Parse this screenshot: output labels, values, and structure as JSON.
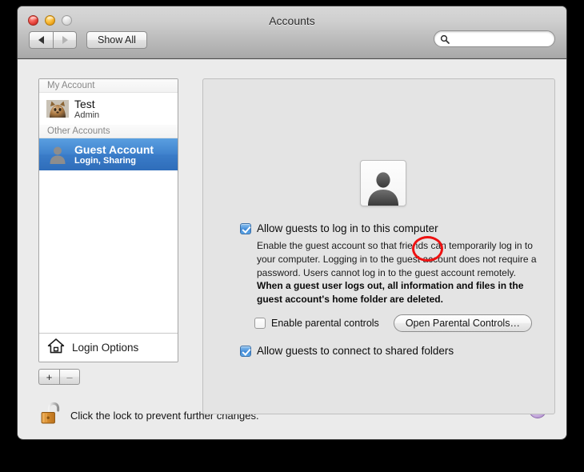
{
  "window": {
    "title": "Accounts",
    "traffic_lights": {
      "close": "close-button",
      "minimize": "minimize-button",
      "zoom": "zoom-button"
    }
  },
  "toolbar": {
    "back_label": "◀",
    "forward_label": "▶",
    "show_all_label": "Show All",
    "search_placeholder": "",
    "search_value": ""
  },
  "sidebar": {
    "groups": [
      {
        "header": "My Account",
        "accounts": [
          {
            "name": "Test",
            "subtitle": "Admin",
            "selected": false,
            "avatar": "cat-photo-avatar"
          }
        ]
      },
      {
        "header": "Other Accounts",
        "accounts": [
          {
            "name": "Guest Account",
            "subtitle": "Login, Sharing",
            "selected": true,
            "avatar": "person-silhouette-avatar"
          }
        ]
      }
    ],
    "login_options_label": "Login Options",
    "add_label": "+",
    "remove_label": "–"
  },
  "detail": {
    "picture_alt": "person-silhouette-picture",
    "allow_login": {
      "label": "Allow guests to log in to this computer",
      "checked": true
    },
    "description": "Enable the guest account so that friends can temporarily log in to your computer. Logging in to the guest account does not require a password. Users cannot log in to the guest account remotely.",
    "warning": "When a guest user logs out, all information and files in the guest account's home folder are deleted.",
    "parental_controls": {
      "label": "Enable parental controls",
      "checked": false,
      "button_label": "Open Parental Controls…"
    },
    "shared_folders": {
      "label": "Allow guests to connect to shared folders",
      "checked": true
    }
  },
  "footer": {
    "lock_message": "Click the lock to prevent further changes.",
    "lock_state": "unlocked",
    "help_label": "?"
  },
  "colors": {
    "selection_blue": "#3f82cd",
    "annotation_red": "#ee1111",
    "help_purple": "#bfa2d8",
    "window_body": "#ebebeb",
    "panel_background": "#e4e4e4"
  }
}
